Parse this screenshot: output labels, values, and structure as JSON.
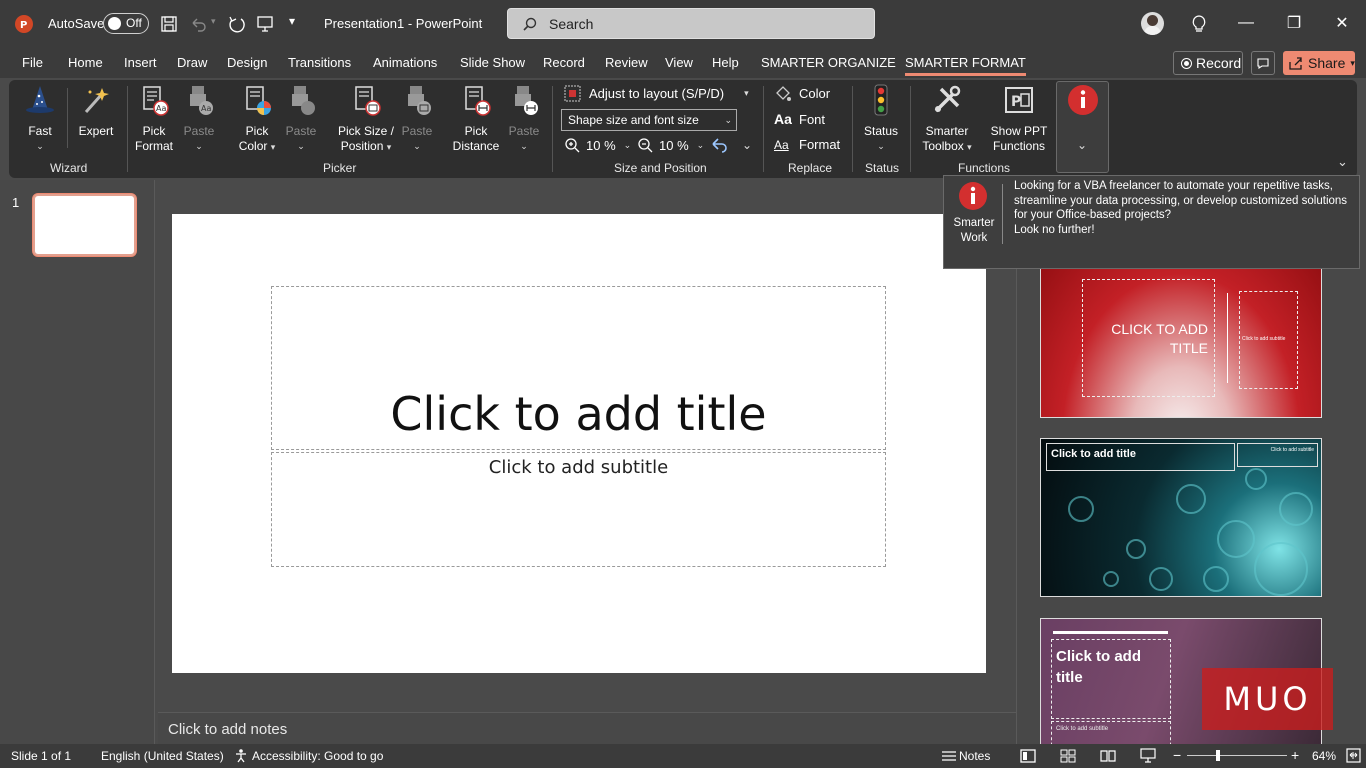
{
  "window": {
    "autosave_label": "AutoSave",
    "autosave_state": "Off",
    "title": "Presentation1  -  PowerPoint",
    "search_placeholder": "Search"
  },
  "menu": {
    "items": [
      "File",
      "Home",
      "Insert",
      "Draw",
      "Design",
      "Transitions",
      "Animations",
      "Slide Show",
      "Record",
      "Review",
      "View",
      "Help",
      "SMARTER ORGANIZE",
      "SMARTER FORMAT"
    ],
    "active": "SMARTER FORMAT",
    "record_label": "Record",
    "share_label": "Share"
  },
  "ribbon": {
    "wizard": {
      "fast": "Fast",
      "expert": "Expert",
      "group": "Wizard"
    },
    "picker": {
      "pick_format_1": "Pick",
      "pick_format_2": "Format",
      "paste": "Paste",
      "pick_color_1": "Pick",
      "pick_color_2": "Color",
      "pick_size_1": "Pick Size /",
      "pick_size_2": "Position",
      "pick_distance_1": "Pick",
      "pick_distance_2": "Distance",
      "group": "Picker"
    },
    "size_position": {
      "adjust": "Adjust to layout (S/P/D)",
      "shape_select": "Shape size and font size",
      "zoom_in_value": "10 %",
      "zoom_out_value": "10 %",
      "group": "Size and Position"
    },
    "replace": {
      "color": "Color",
      "font": "Font",
      "format": "Format",
      "group": "Replace"
    },
    "status": {
      "label": "Status",
      "group": "Status"
    },
    "functions": {
      "toolbox_1": "Smarter",
      "toolbox_2": "Toolbox",
      "show_ppt_1": "Show PPT",
      "show_ppt_2": "Functions",
      "group": "Functions"
    },
    "colors": {
      "accent": "#ee8a72",
      "info_red": "#d32f2f"
    }
  },
  "slides_panel": {
    "slide_number": "1"
  },
  "slide": {
    "title_placeholder": "Click to add title",
    "subtitle_placeholder": "Click to add subtitle"
  },
  "notes": {
    "placeholder": "Click to add notes"
  },
  "tooltip": {
    "icon_label_1": "Smarter",
    "icon_label_2": "Work",
    "message": "Looking for a VBA freelancer to automate your repetitive tasks, streamline your data processing, or develop customized solutions for your Office-based projects?",
    "cta": "Look no further!"
  },
  "designer": {
    "design1_title": "CLICK TO ADD TITLE",
    "design1_subtitle": "Click to add subtitle",
    "design2_title": "Click to add title",
    "design2_subtitle": "Click to add subtitle",
    "design3_title": "Click to add title",
    "design3_subtitle": "Click to add subtitle"
  },
  "watermark": "MUO",
  "statusbar": {
    "slide_info": "Slide 1 of 1",
    "language": "English (United States)",
    "accessibility": "Accessibility: Good to go",
    "notes": "Notes",
    "zoom_minus": "−",
    "zoom_plus": "+",
    "zoom": "64%"
  }
}
